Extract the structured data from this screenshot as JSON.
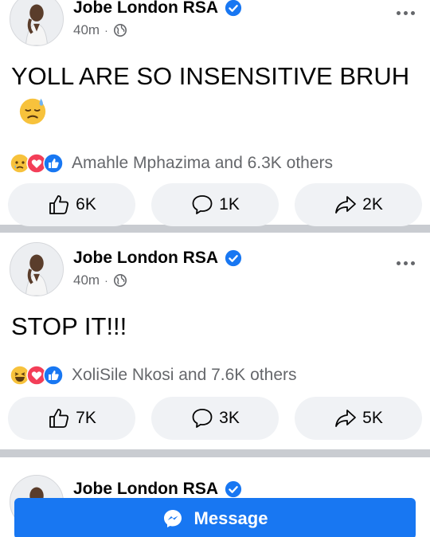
{
  "posts": [
    {
      "author": "Jobe London RSA",
      "time": "40m",
      "separator": "·",
      "text": "YOLL ARE SO INSENSITIVE BRUH",
      "text_emoji": "downcast-face-with-sweat-emoji",
      "reactions": {
        "icons": [
          "sad-reaction-icon",
          "love-reaction-icon",
          "like-reaction-icon"
        ],
        "summary": "Amahle Mphazima and 6.3K others"
      },
      "actions": {
        "like_count": "6K",
        "comment_count": "1K",
        "share_count": "2K"
      }
    },
    {
      "author": "Jobe London RSA",
      "time": "40m",
      "separator": "·",
      "text": "STOP IT!!!",
      "reactions": {
        "icons": [
          "haha-reaction-icon",
          "love-reaction-icon",
          "like-reaction-icon"
        ],
        "summary": "XoliSile Nkosi and 7.6K others"
      },
      "actions": {
        "like_count": "7K",
        "comment_count": "3K",
        "share_count": "5K"
      }
    },
    {
      "author": "Jobe London RSA"
    }
  ],
  "message_button": {
    "label": "Message",
    "icon": "messenger-icon"
  },
  "colors": {
    "brand_blue": "#1877f2",
    "action_bg": "#f0f2f5",
    "meta_gray": "#65676b",
    "separator": "#c9ccd1"
  }
}
